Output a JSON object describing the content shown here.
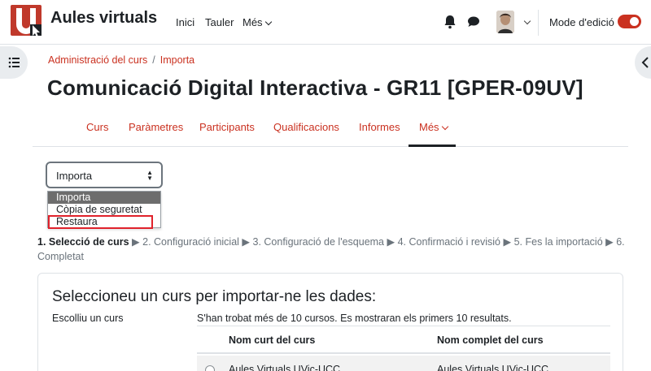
{
  "navbar": {
    "brand": "Aules virtuals",
    "links": [
      "Inici",
      "Tauler",
      "Més"
    ],
    "mode_label": "Mode d'edició",
    "accent_color": "#ca3120"
  },
  "breadcrumb": [
    "Administració del curs",
    "Importa"
  ],
  "page_title": "Comunicació Digital Interactiva - GR11 [GPER-09UV]",
  "secondary_nav": [
    "Curs",
    "Paràmetres",
    "Participants",
    "Qualificacions",
    "Informes",
    "Més"
  ],
  "select": {
    "value": "Importa",
    "options": [
      "Importa",
      "Còpia de seguretat",
      "Restaura"
    ]
  },
  "steps": {
    "current": "1. Selecció de curs",
    "rest": [
      "2. Configuració inicial",
      "3. Configuració de l'esquema",
      "4. Confirmació i revisió",
      "5. Fes la importació",
      "6. Completat"
    ]
  },
  "card": {
    "title": "Seleccioneu un curs per importar-ne les dades:",
    "label": "Escolliu un curs",
    "info": "S'han trobat més de 10 cursos. Es mostraran els primers 10 resultats.",
    "columns": [
      "Nom curt del curs",
      "Nom complet del curs"
    ],
    "rows": [
      {
        "short": "Aules Virtuals UVic-UCC",
        "full": "Aules Virtuals UVic-UCC"
      }
    ]
  }
}
